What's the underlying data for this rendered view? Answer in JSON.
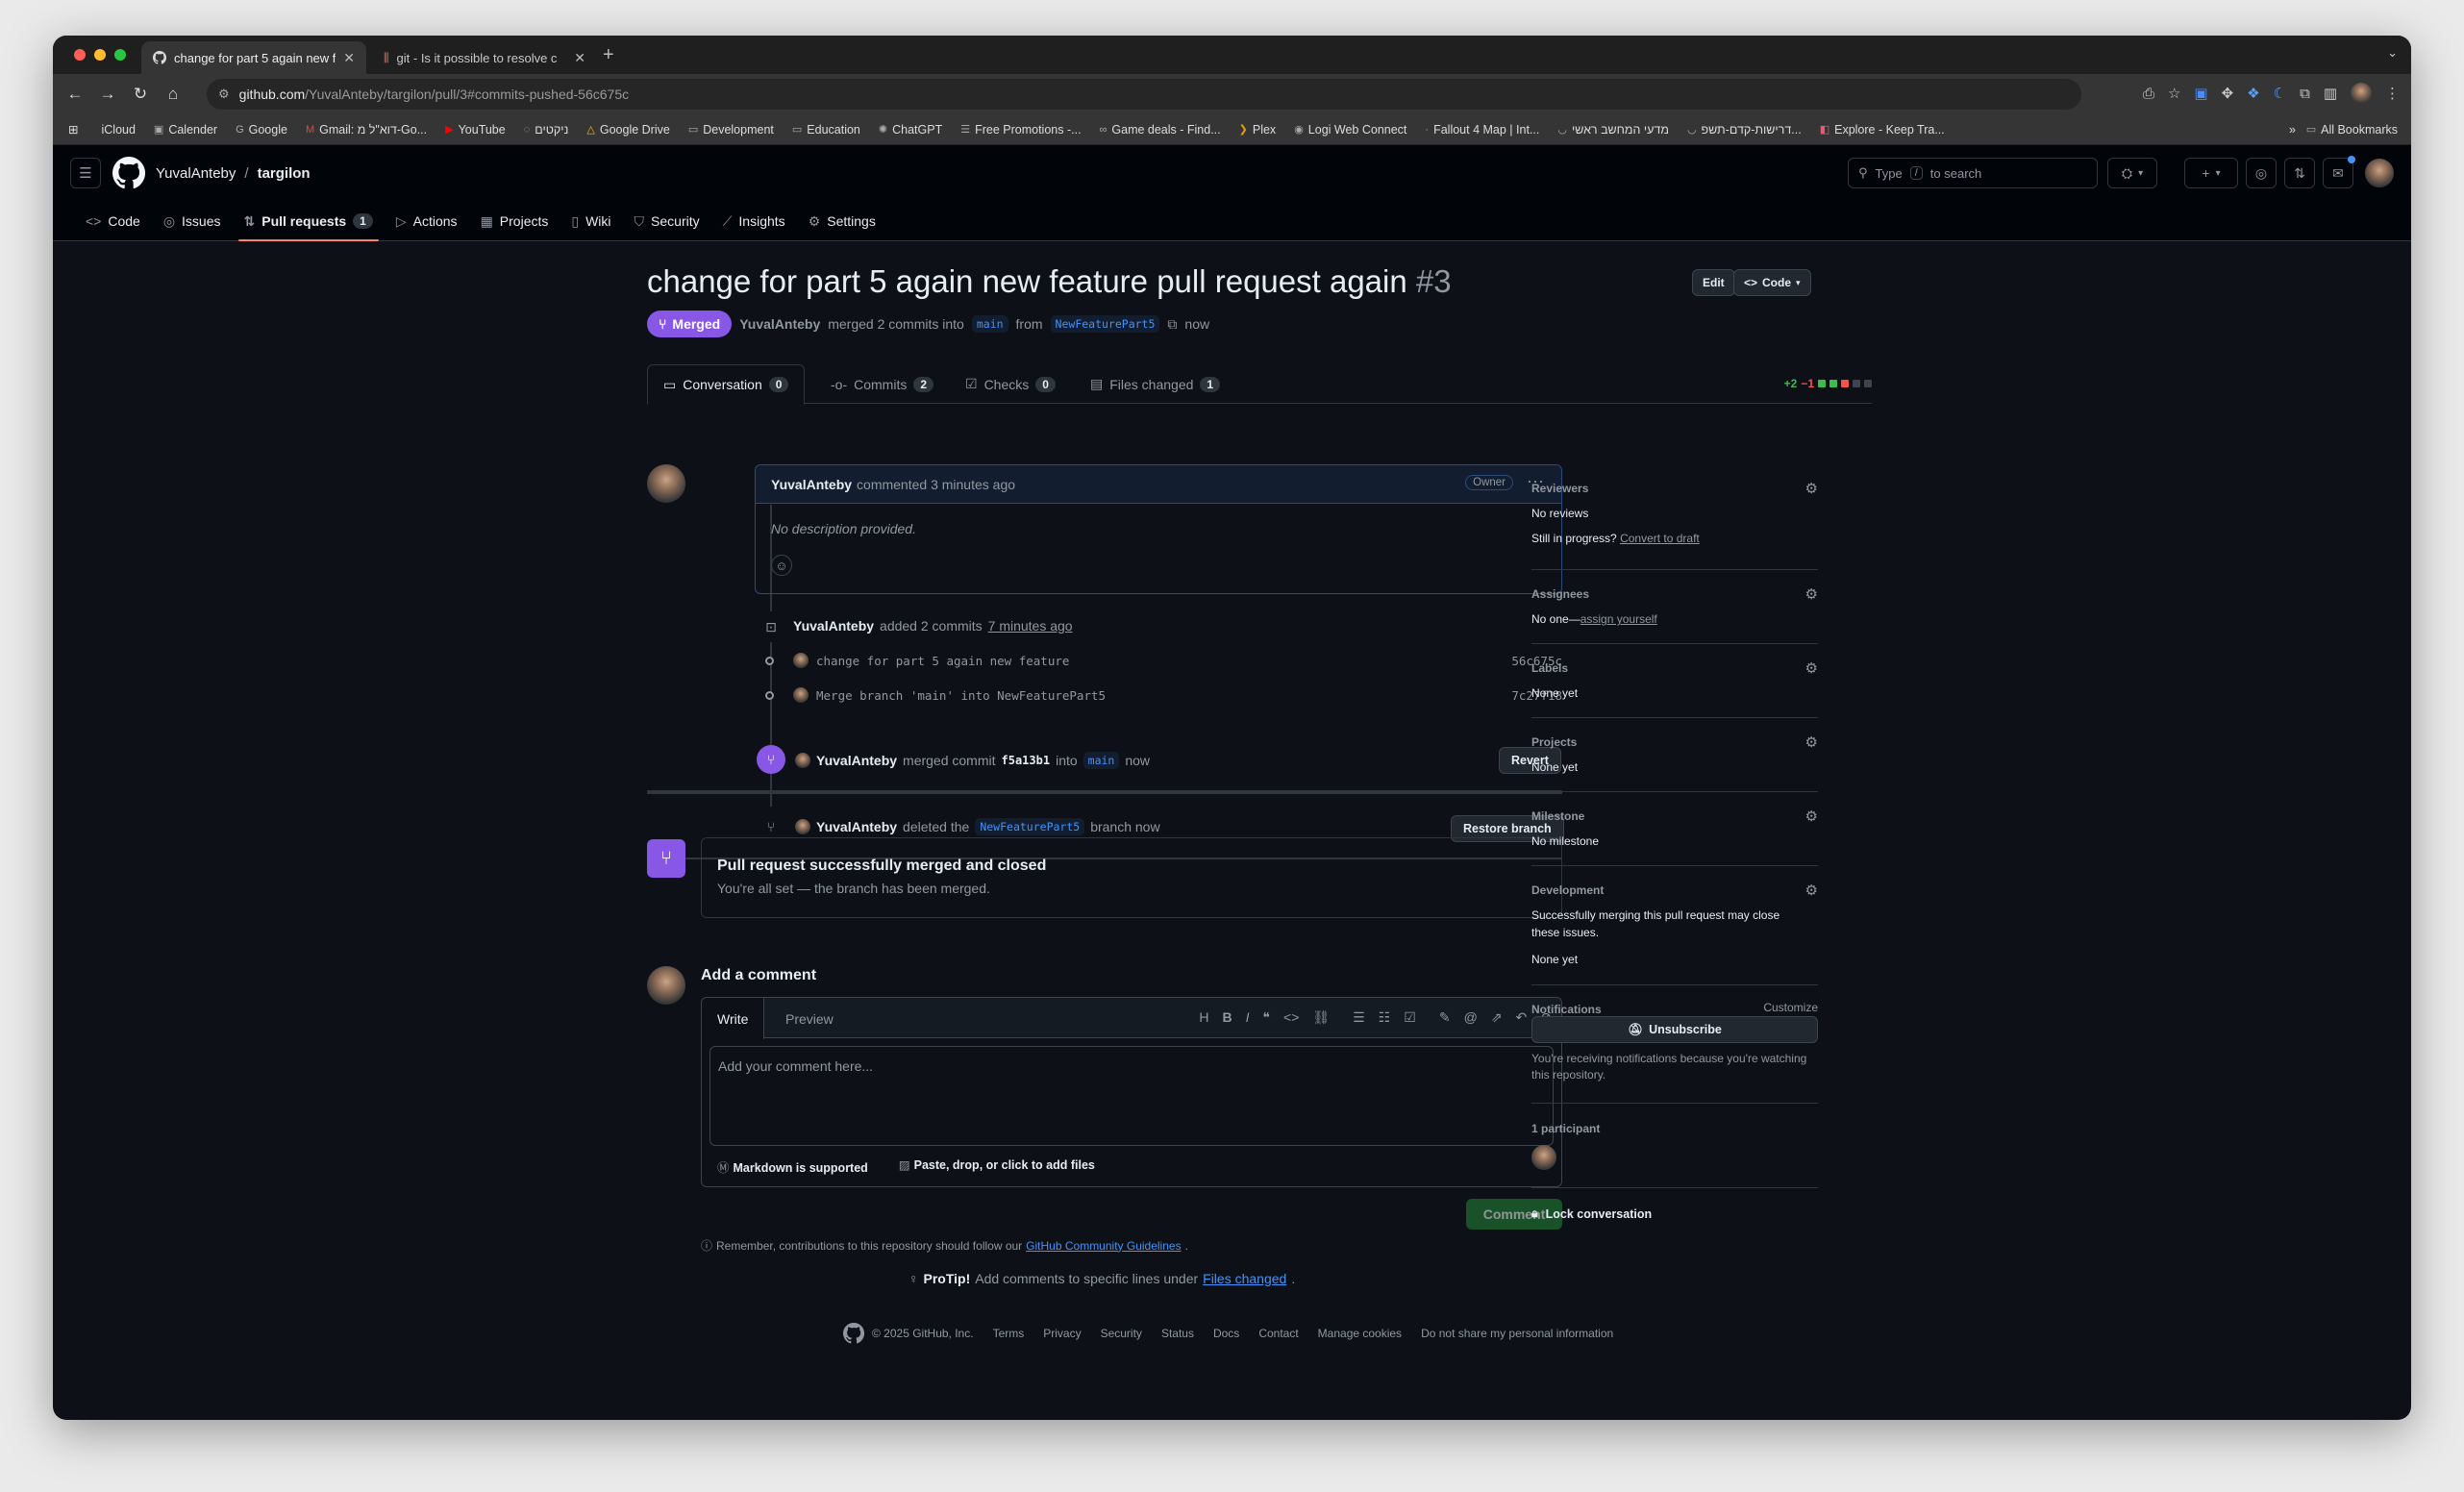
{
  "browser": {
    "tabs": [
      {
        "title": "change for part 5 again new f",
        "active": true
      },
      {
        "title": "git - Is it possible to resolve c",
        "active": false
      }
    ],
    "url_domain": "github.com",
    "url_path": "/YuvalAnteby/targilon/pull/3#commits-pushed-56c675c",
    "bookmarks": [
      "iCloud",
      "Calender",
      "Google",
      "Gmail: דוא\"ל מ-Go...",
      "YouTube",
      "ניקטים",
      "Google Drive",
      "Development",
      "Education",
      "ChatGPT",
      "Free Promotions -...",
      "Game deals - Find...",
      "Plex",
      "Logi Web Connect",
      "Fallout 4 Map | Int...",
      "מדעי המחשב ראשי",
      "דרישות-קדם-תשפ...",
      "Explore - Keep Tra..."
    ],
    "all_bookmarks": "All Bookmarks"
  },
  "header": {
    "owner": "YuvalAnteby",
    "sep": "/",
    "repo": "targilon",
    "search_pre": "Type",
    "search_key": "/",
    "search_post": "to search"
  },
  "repo_tabs": [
    {
      "label": "Code",
      "icon": "<>"
    },
    {
      "label": "Issues",
      "icon": "◎"
    },
    {
      "label": "Pull requests",
      "icon": "⇅",
      "count": "1"
    },
    {
      "label": "Actions",
      "icon": "▷"
    },
    {
      "label": "Projects",
      "icon": "▦"
    },
    {
      "label": "Wiki",
      "icon": "▯"
    },
    {
      "label": "Security",
      "icon": "⛉"
    },
    {
      "label": "Insights",
      "icon": "⟋"
    },
    {
      "label": "Settings",
      "icon": "⚙"
    }
  ],
  "pr": {
    "title": "change for part 5 again new feature pull request again",
    "number": "#3",
    "edit": "Edit",
    "code": "Code",
    "state": "Merged",
    "author": "YuvalAnteby",
    "merged_text": "merged 2 commits into",
    "base": "main",
    "from": "from",
    "head": "NewFeaturePart5",
    "when": "now"
  },
  "pr_tabs": [
    {
      "label": "Conversation",
      "count": "0"
    },
    {
      "label": "Commits",
      "count": "2"
    },
    {
      "label": "Checks",
      "count": "0"
    },
    {
      "label": "Files changed",
      "count": "1"
    }
  ],
  "diffstat": {
    "add": "+2",
    "del": "−1"
  },
  "comment": {
    "author": "YuvalAnteby",
    "meta": "commented 3 minutes ago",
    "role": "Owner",
    "body": "No description provided."
  },
  "timeline": {
    "added_user": "YuvalAnteby",
    "added_text": "added 2 commits",
    "added_when": "7 minutes ago",
    "commits": [
      {
        "msg": "change for part 5 again new feature",
        "sha": "56c675c"
      },
      {
        "msg": "Merge branch 'main' into NewFeaturePart5",
        "sha": "7c27f18"
      }
    ],
    "merge_user": "YuvalAnteby",
    "merge_text": "merged commit",
    "merge_sha": "f5a13b1",
    "merge_into": "into",
    "merge_base": "main",
    "merge_when": "now",
    "revert": "Revert",
    "deleted_user": "YuvalAnteby",
    "deleted_text": "deleted the",
    "deleted_branch": "NewFeaturePart5",
    "deleted_tail": "branch now",
    "restore": "Restore branch"
  },
  "merged_box": {
    "title": "Pull request successfully merged and closed",
    "sub": "You're all set — the branch has been merged."
  },
  "composer": {
    "heading": "Add a comment",
    "write": "Write",
    "preview": "Preview",
    "placeholder": "Add your comment here...",
    "markdown": "Markdown is supported",
    "files": "Paste, drop, or click to add files",
    "submit": "Comment",
    "remember_pre": "Remember, contributions to this repository should follow our",
    "remember_link": "GitHub Community Guidelines",
    "protip_b": "ProTip!",
    "protip_t": "Add comments to specific lines under",
    "protip_link": "Files changed"
  },
  "sidebar": {
    "reviewers_h": "Reviewers",
    "reviewers_v": "No reviews",
    "progress": "Still in progress?",
    "draft": "Convert to draft",
    "assignees_h": "Assignees",
    "assignees_v": "No one—",
    "assign_link": "assign yourself",
    "labels_h": "Labels",
    "labels_v": "None yet",
    "projects_h": "Projects",
    "projects_v": "None yet",
    "milestone_h": "Milestone",
    "milestone_v": "No milestone",
    "dev_h": "Development",
    "dev_v1": "Successfully merging this pull request may close",
    "dev_v2": "these issues.",
    "dev_v3": "None yet",
    "notif_h": "Notifications",
    "customize": "Customize",
    "unsubscribe": "Unsubscribe",
    "notif_note": "You're receiving notifications because you're watching this repository.",
    "participants": "1 participant",
    "lock": "Lock conversation"
  },
  "footer": [
    "© 2025 GitHub, Inc.",
    "Terms",
    "Privacy",
    "Security",
    "Status",
    "Docs",
    "Contact",
    "Manage cookies",
    "Do not share my personal information"
  ]
}
